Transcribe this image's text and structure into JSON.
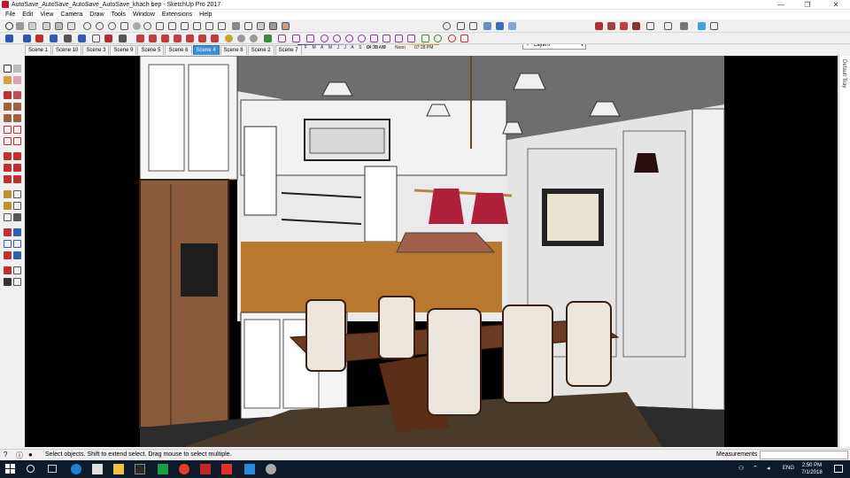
{
  "window": {
    "title": "AutoSave_AutoSave_AutoSave_AutoSave_khach bep - SketchUp Pro 2017",
    "minimize_glyph": "—",
    "maximize_glyph": "❐",
    "close_glyph": "✕"
  },
  "menu": [
    "File",
    "Edit",
    "View",
    "Camera",
    "Draw",
    "Tools",
    "Window",
    "Extensions",
    "Help"
  ],
  "shadow_settings": {
    "months": [
      "J",
      "F",
      "M",
      "A",
      "M",
      "J",
      "J",
      "A",
      "S",
      "O",
      "N",
      "D"
    ],
    "time_start": "04:37 AM",
    "time_noon": "Noon",
    "time_end": "07:28 PM"
  },
  "layer": {
    "current": "Layer0"
  },
  "scenes": [
    {
      "label": "Scene 1",
      "active": false
    },
    {
      "label": "Scene 10",
      "active": false
    },
    {
      "label": "Scene 3",
      "active": false
    },
    {
      "label": "Scene 9",
      "active": false
    },
    {
      "label": "Scene 5",
      "active": false
    },
    {
      "label": "Scene 6",
      "active": false
    },
    {
      "label": "Scene 4",
      "active": true
    },
    {
      "label": "Scene 8",
      "active": false
    },
    {
      "label": "Scene 2",
      "active": false
    },
    {
      "label": "Scene 7",
      "active": false
    }
  ],
  "tray": {
    "label": "Default Tray"
  },
  "status": {
    "hint": "Select objects. Shift to extend select. Drag mouse to select multiple.",
    "measurements_label": "Measurements",
    "measurements_value": ""
  },
  "taskbar": {
    "lang": "ENG",
    "time": "2:50 PM",
    "date": "7/1/2018"
  },
  "colors": {
    "scene_active": "#3a8fd8",
    "taskbar": "#0c1a2a",
    "backsplash": "#b8782e",
    "fridge": "#8a5a3c",
    "lamp_shade": "#b0203a"
  }
}
